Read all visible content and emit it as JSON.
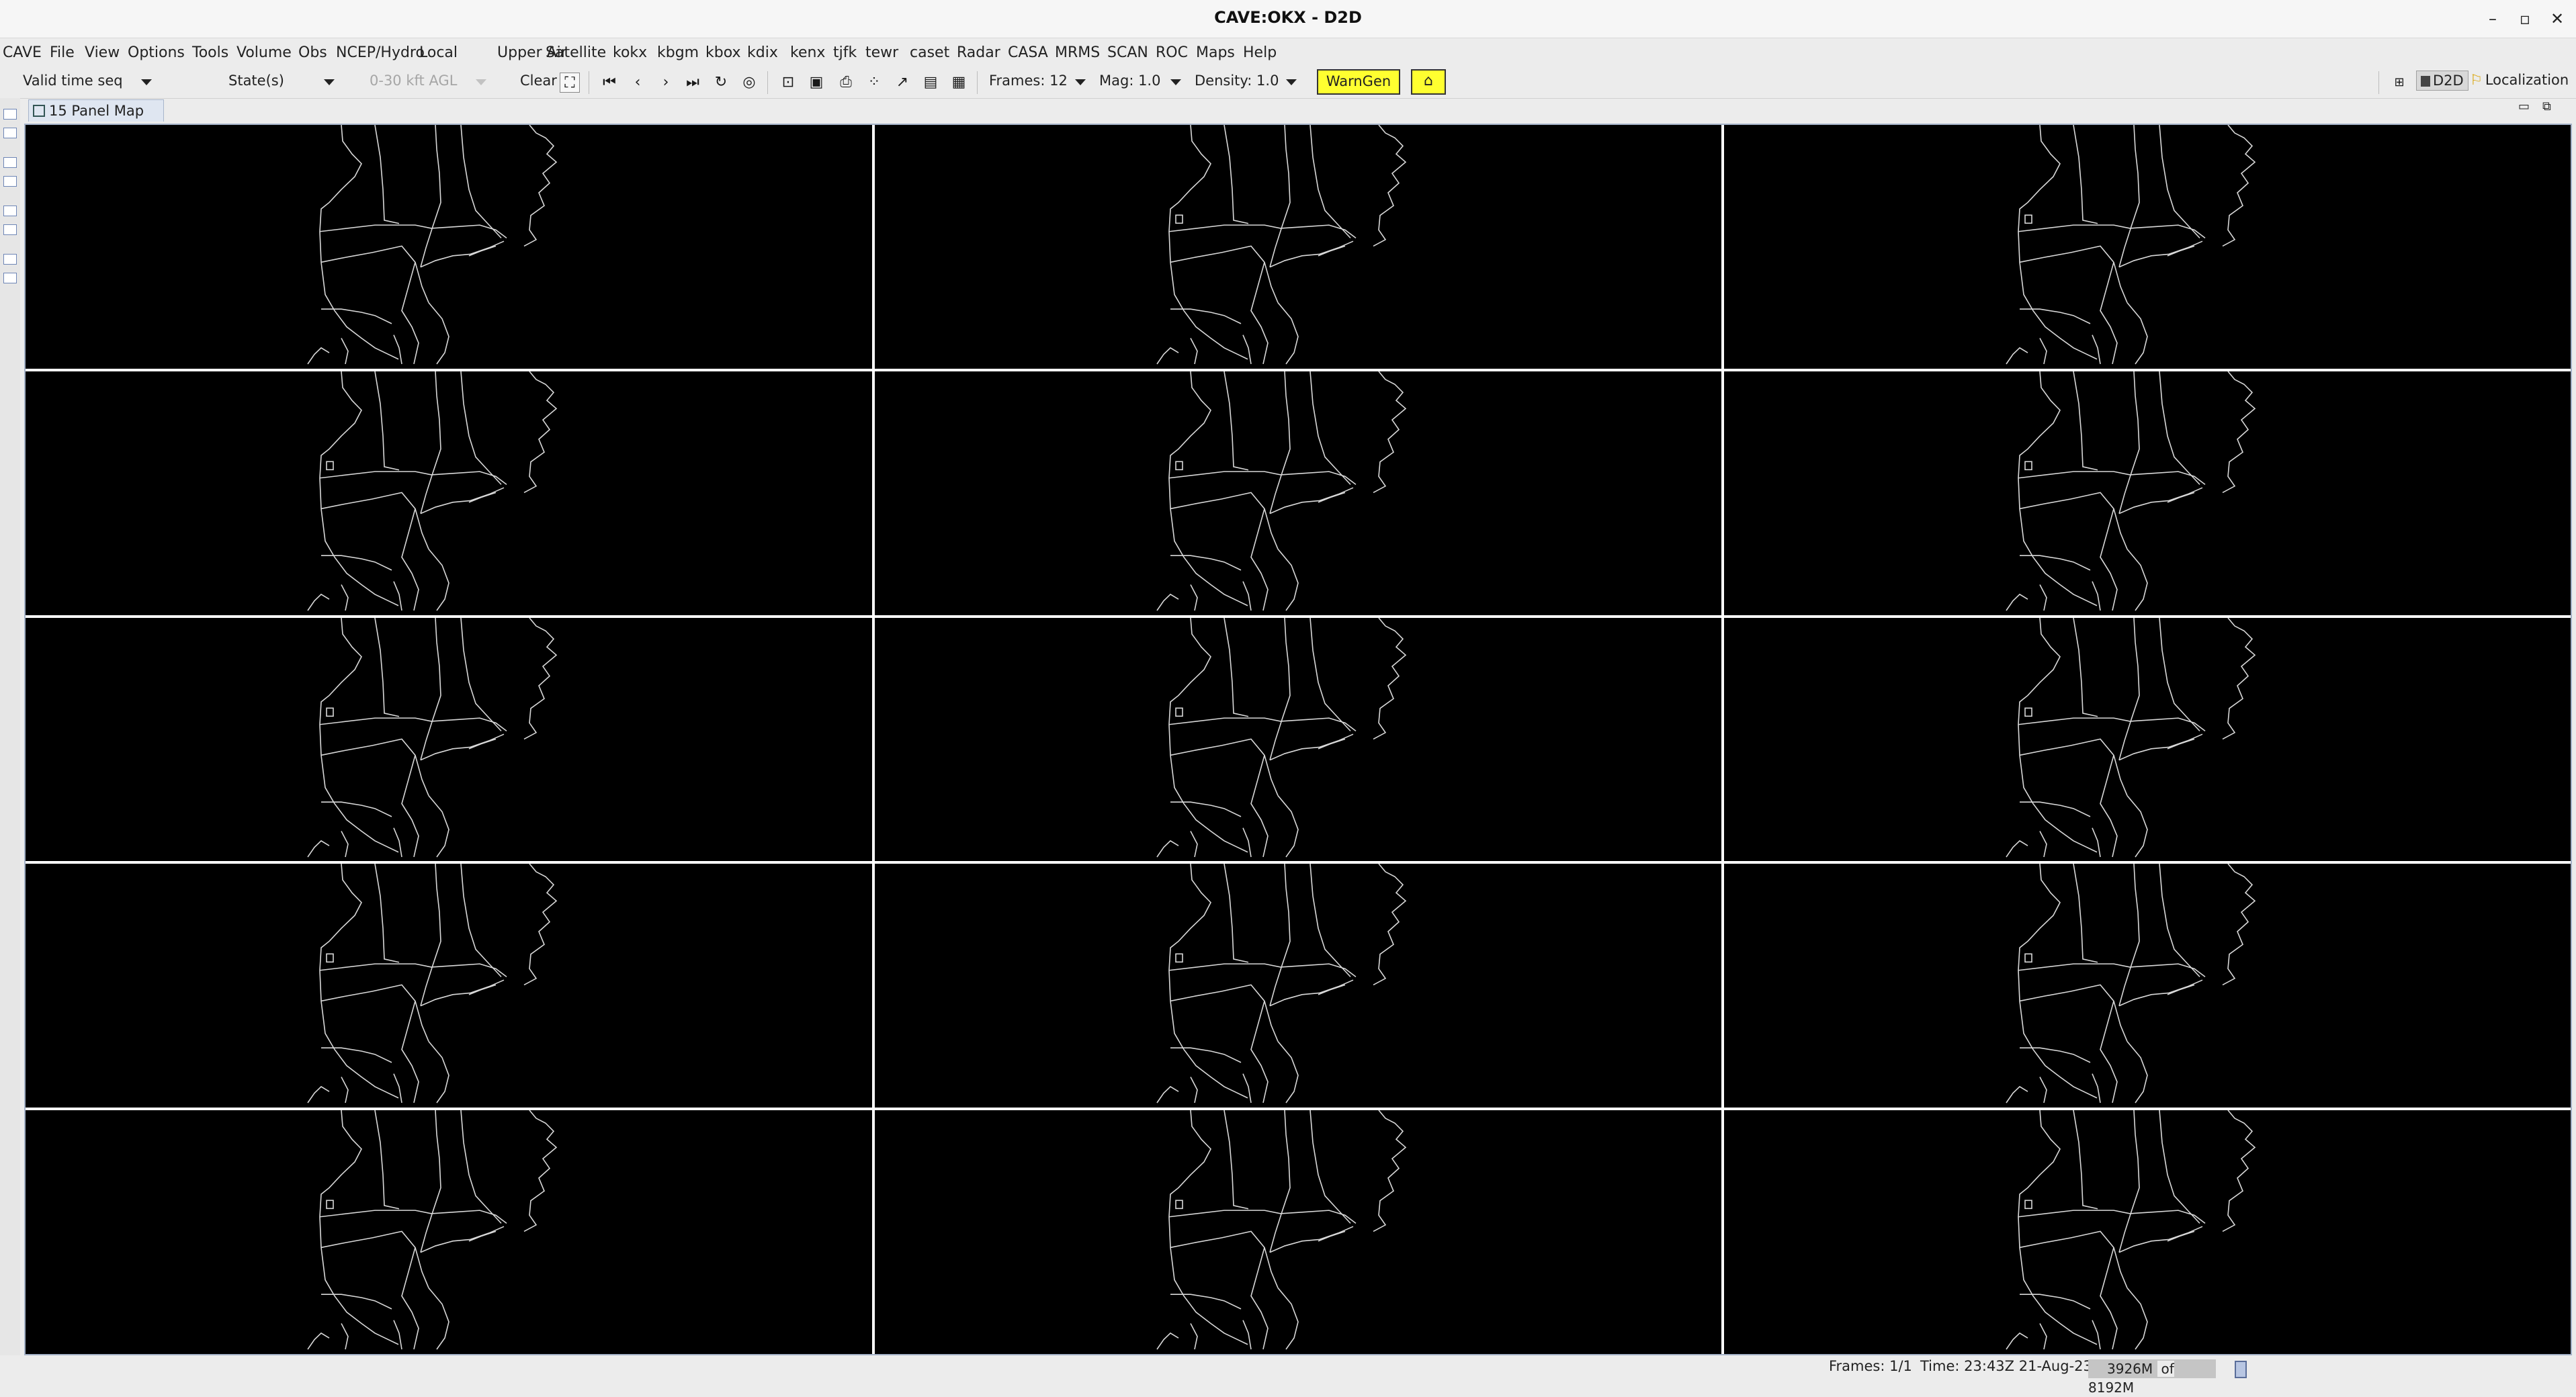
{
  "window": {
    "title": "CAVE:OKX - D2D",
    "minimize": "–",
    "maximize": "▫",
    "close": "✕"
  },
  "menubar": [
    "CAVE",
    "File",
    "View",
    "Options",
    "Tools",
    "Volume",
    "Obs",
    "NCEP/Hydro",
    "Local",
    "Upper Air",
    "Satellite",
    "kokx",
    "kbgm",
    "kbox",
    "kdix",
    "kenx",
    "tjfk",
    "tewr",
    "caset",
    "Radar",
    "CASA",
    "MRMS",
    "SCAN",
    "ROC",
    "Maps",
    "Help"
  ],
  "toolbar": {
    "time_mode": "Valid time seq",
    "state": "State(s)",
    "layer": "0-30 kft AGL",
    "clear": "Clear",
    "frames": "Frames: 12",
    "mag": "Mag: 1.0",
    "density": "Density: 1.0",
    "warngen": "WarnGen",
    "perspective_d2d": "D2D",
    "perspective_localization": "Localization",
    "icons": {
      "first": "first-frame-icon",
      "prev": "previous-frame-icon",
      "next": "next-frame-icon",
      "last": "last-frame-icon",
      "loop": "loop-icon",
      "time_options": "time-options-icon"
    }
  },
  "editor": {
    "tab_label": "15 Panel Map",
    "close_label": "×"
  },
  "map": {
    "rows": 5,
    "cols": 3,
    "panel_bg": "#000000",
    "outline_color": "#d8d8d8",
    "divider_color": "#ffffff"
  },
  "status": {
    "frames": "Frames: 1/1",
    "time": "Time: 23:43Z 21-Aug-23",
    "memory_used": "3926M",
    "memory_total": "of 8192M"
  }
}
